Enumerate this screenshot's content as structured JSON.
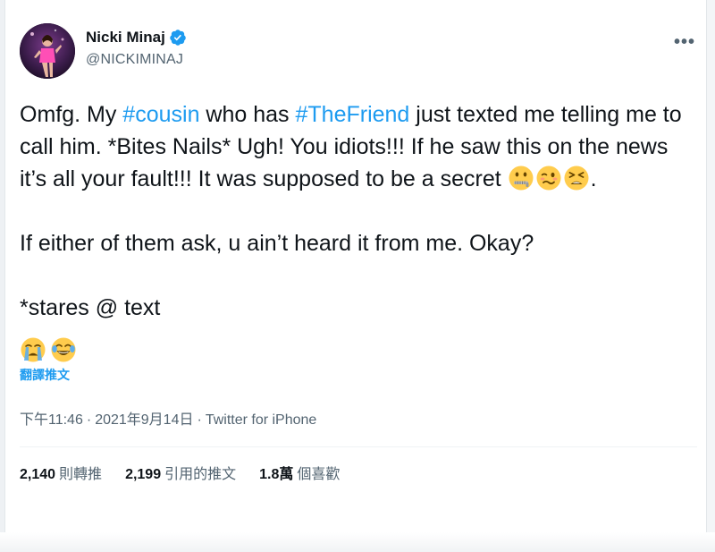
{
  "user": {
    "display_name": "Nicki Minaj",
    "handle": "@NICKIMINAJ",
    "verified_icon": "verified-badge-icon"
  },
  "tweet": {
    "line1_before": "Omfg. My ",
    "hashtag1": "#cousin",
    "line1_mid": " who has ",
    "hashtag2": "#TheFriend",
    "line1_after": " just texted me telling me to call him. *Bites Nails* Ugh! You idiots!!! If he saw this on the news it’s all your fault!!! It was supposed to be a secret ",
    "line1_end": ".",
    "emojis_inline": [
      "zipper-mouth-face",
      "woozy-face",
      "tired-face"
    ],
    "para2": "If either of them ask, u ain’t heard it from me. Okay?",
    "para3": "*stares @ text",
    "emojis_final": [
      "loudly-crying-face",
      "face-with-tears-of-joy"
    ],
    "translate_label": "翻譯推文"
  },
  "meta": {
    "time": "下午11:46",
    "separator": "·",
    "date": "2021年9月14日",
    "source": "Twitter for iPhone"
  },
  "stats": {
    "retweets_count": "2,140",
    "retweets_label": "則轉推",
    "quotes_count": "2,199",
    "quotes_label": "引用的推文",
    "likes_count": "1.8萬",
    "likes_label": "個喜歡"
  },
  "colors": {
    "accent": "#1d9bf0",
    "text": "#0f1419",
    "secondary": "#536471"
  }
}
